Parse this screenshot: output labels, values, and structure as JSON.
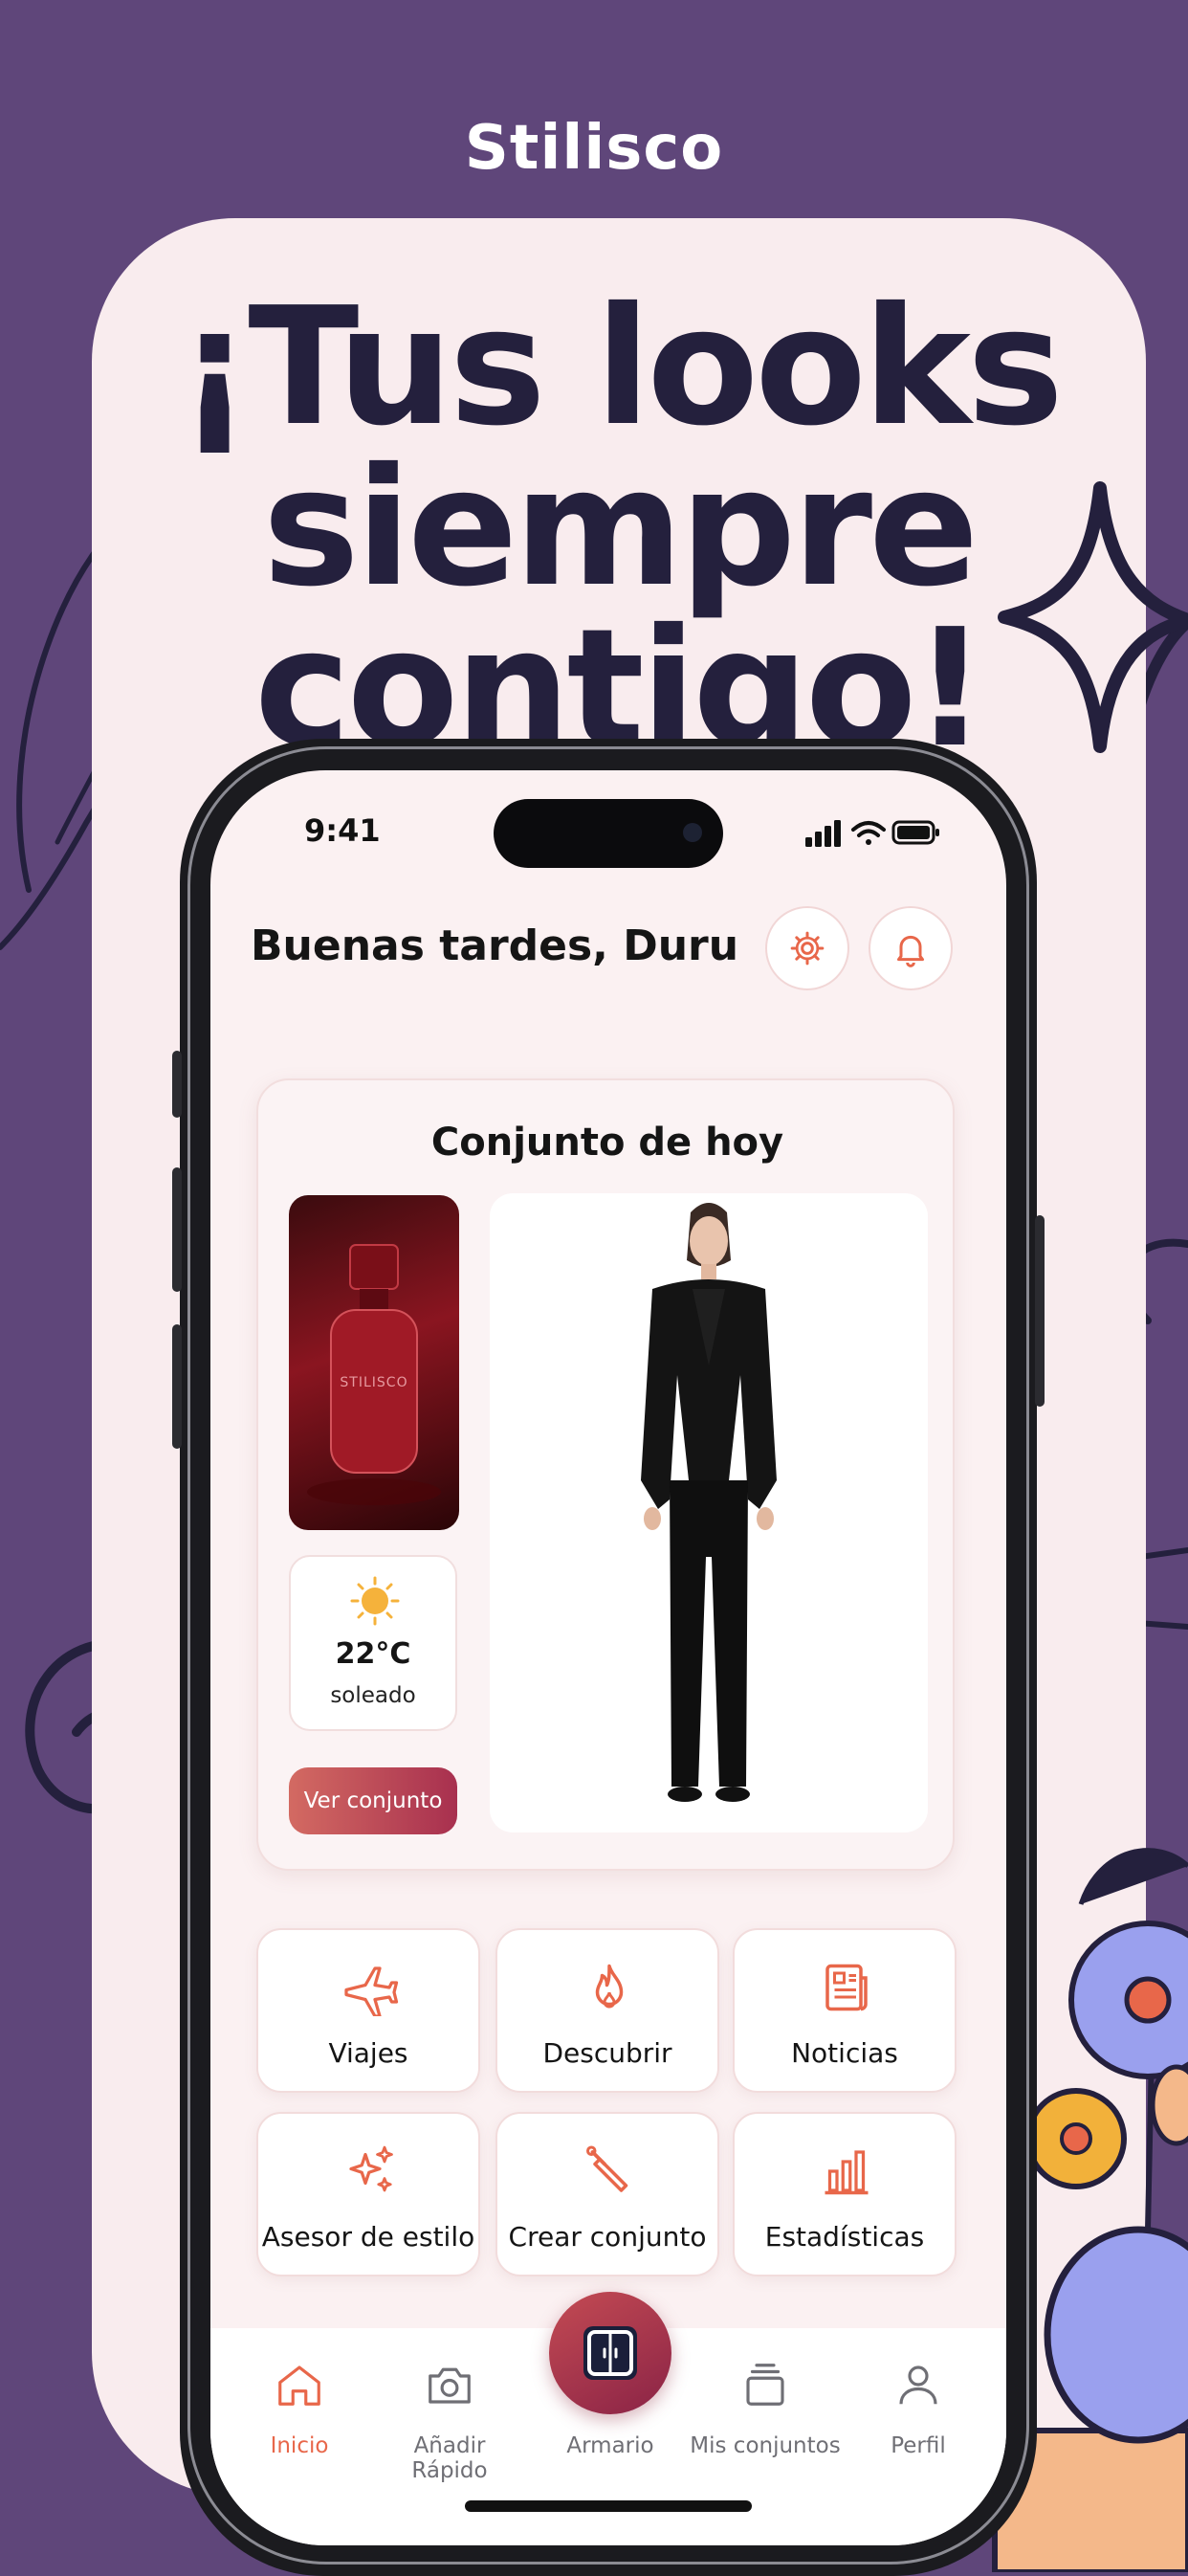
{
  "brand": "Stilisco",
  "headline": [
    "¡Tus looks",
    "siempre",
    "contigo!"
  ],
  "status": {
    "time": "9:41"
  },
  "greeting": "Buenas tardes, Duru",
  "today": {
    "title": "Conjunto de hoy",
    "perfume_label": "STILISCO",
    "weather": {
      "temperature": "22°C",
      "condition": "soleado",
      "icon": "sun-icon"
    },
    "view_button": "Ver conjunto"
  },
  "tiles": [
    {
      "label": "Viajes",
      "icon": "plane-icon"
    },
    {
      "label": "Descubrir",
      "icon": "flame-icon"
    },
    {
      "label": "Noticias",
      "icon": "newspaper-icon"
    },
    {
      "label": "Asesor de estilo",
      "icon": "sparkles-icon"
    },
    {
      "label": "Crear conjunto",
      "icon": "hanger-icon"
    },
    {
      "label": "Estadísticas",
      "icon": "bar-chart-icon"
    }
  ],
  "tabs": [
    {
      "label": "Inicio",
      "icon": "home-icon",
      "active": true
    },
    {
      "label": "Añadir Rápido",
      "icon": "camera-icon"
    },
    {
      "label": "Armario",
      "icon": "wardrobe-icon"
    },
    {
      "label": "Mis conjuntos",
      "icon": "stack-icon"
    },
    {
      "label": "Perfil",
      "icon": "user-icon"
    }
  ],
  "colors": {
    "background": "#5f467a",
    "card": "#f9ecee",
    "accent": "#e8674a",
    "headline": "#24203d"
  }
}
